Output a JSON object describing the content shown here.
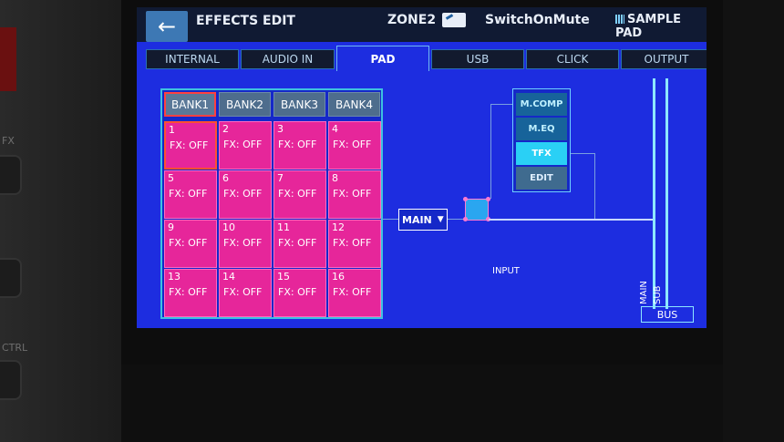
{
  "header": {
    "title": "EFFECTS EDIT",
    "zone": "ZONE2",
    "kit_name": "SwitchOnMute",
    "mode": "SAMPLE PAD",
    "back_symbol": "←"
  },
  "tabs": [
    {
      "label": "INTERNAL"
    },
    {
      "label": "AUDIO IN"
    },
    {
      "label": "PAD",
      "active": true
    },
    {
      "label": "USB"
    },
    {
      "label": "CLICK"
    },
    {
      "label": "OUTPUT"
    }
  ],
  "banks": [
    "BANK1",
    "BANK2",
    "BANK3",
    "BANK4"
  ],
  "selected_bank": "BANK1",
  "pads": [
    {
      "num": "1",
      "fx": "FX: OFF"
    },
    {
      "num": "2",
      "fx": "FX: OFF"
    },
    {
      "num": "3",
      "fx": "FX: OFF"
    },
    {
      "num": "4",
      "fx": "FX: OFF"
    },
    {
      "num": "5",
      "fx": "FX: OFF"
    },
    {
      "num": "6",
      "fx": "FX: OFF"
    },
    {
      "num": "7",
      "fx": "FX: OFF"
    },
    {
      "num": "8",
      "fx": "FX: OFF"
    },
    {
      "num": "9",
      "fx": "FX: OFF"
    },
    {
      "num": "10",
      "fx": "FX: OFF"
    },
    {
      "num": "11",
      "fx": "FX: OFF"
    },
    {
      "num": "12",
      "fx": "FX: OFF"
    },
    {
      "num": "13",
      "fx": "FX: OFF"
    },
    {
      "num": "14",
      "fx": "FX: OFF"
    },
    {
      "num": "15",
      "fx": "FX: OFF"
    },
    {
      "num": "16",
      "fx": "FX: OFF"
    }
  ],
  "selected_pad": "1",
  "routing": {
    "output_select": "MAIN",
    "input_label": "INPUT",
    "fx_chain": [
      "M.COMP",
      "M.EQ",
      "TFX",
      "EDIT"
    ],
    "active_fx": "TFX",
    "bus_labels": [
      "MAIN",
      "SUB"
    ],
    "bus_button": "BUS"
  },
  "device": {
    "side_label": "FX",
    "side_label2": "CTRL"
  },
  "colors": {
    "screen_bg": "#1d2de0",
    "pad_color": "#e6269a",
    "accent": "#2ad0f5",
    "selection": "#ff4040"
  }
}
